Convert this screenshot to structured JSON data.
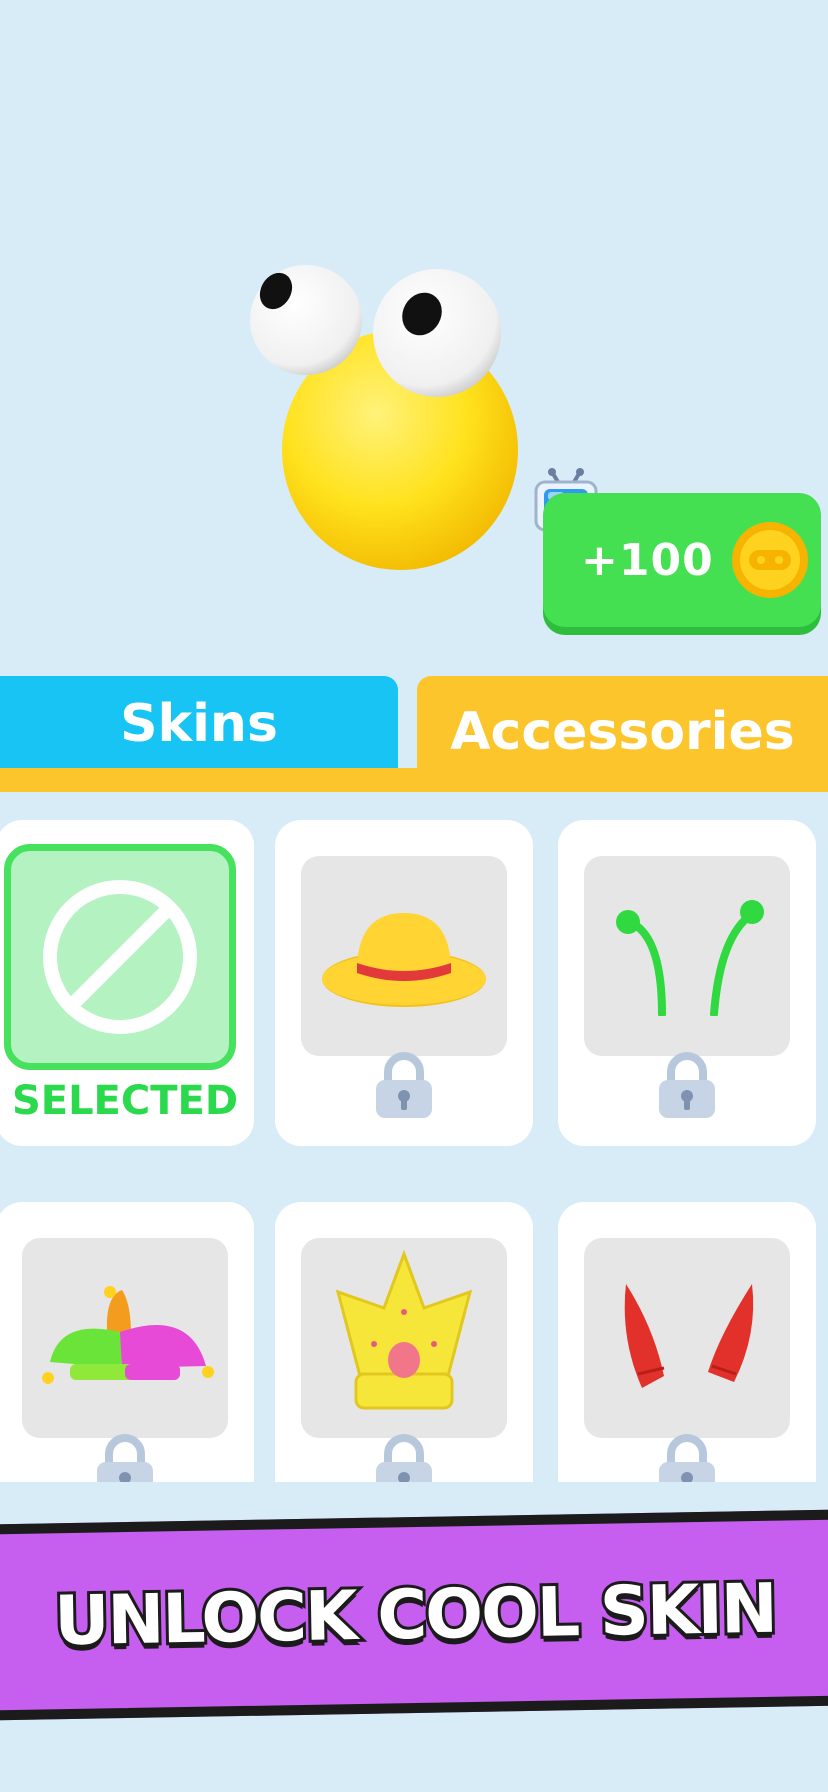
{
  "reward": {
    "amount": "+100"
  },
  "tabs": [
    {
      "label": "Skins",
      "active": false
    },
    {
      "label": "Accessories",
      "active": true
    }
  ],
  "items": [
    {
      "name": "none",
      "status_label": "SELECTED",
      "locked": false,
      "selected": true
    },
    {
      "name": "straw-hat",
      "locked": true
    },
    {
      "name": "antennae",
      "locked": true
    },
    {
      "name": "jester-hat",
      "locked": true
    },
    {
      "name": "crown",
      "locked": true
    },
    {
      "name": "devil-horns",
      "locked": true
    }
  ],
  "banner": {
    "text": "UNLOCK COOL SKIN"
  },
  "colors": {
    "background": "#d8ecf8",
    "skins_tab": "#18c4f4",
    "accessories_tab": "#fcc52c",
    "reward_green": "#44e052",
    "selected_green": "#46e25e",
    "banner_purple": "#c65ef0"
  }
}
